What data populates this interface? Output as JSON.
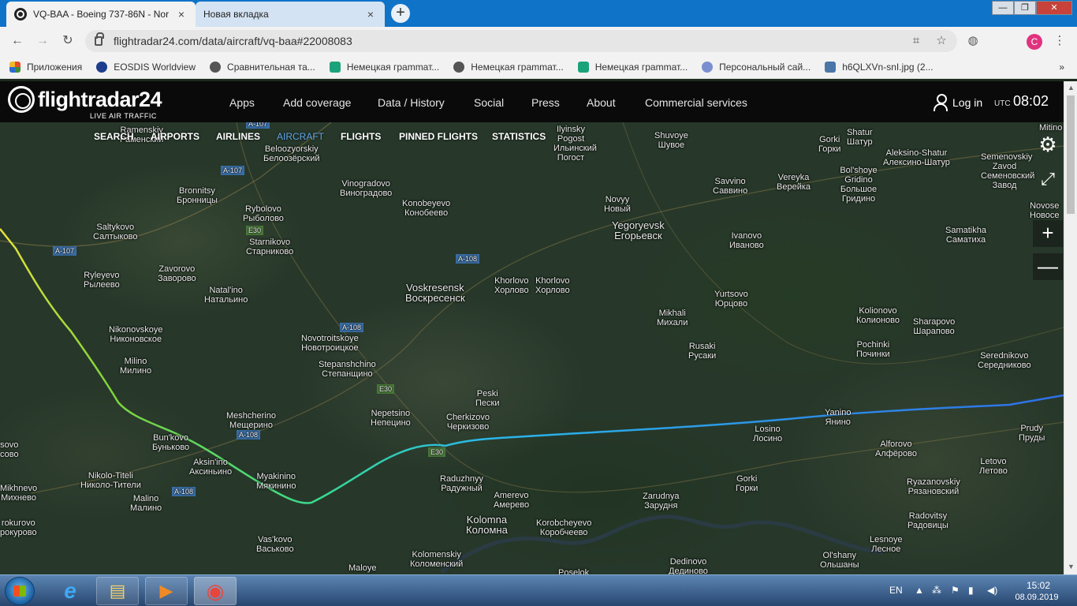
{
  "browser": {
    "tabs": [
      {
        "title": "VQ-BAA - Boeing 737-86N - Nor",
        "close": "×"
      },
      {
        "title": "Новая вкладка",
        "close": "×"
      }
    ],
    "new_tab": "+",
    "window": {
      "minimize": "—",
      "maximize": "❐",
      "close": "✕"
    },
    "url": "flightradar24.com/data/aircraft/vq-baa#22008083",
    "profile_initial": "C",
    "bookmarks": [
      {
        "label": "Приложения",
        "color": "#e44d26"
      },
      {
        "label": "EOSDIS Worldview",
        "color": "#1e3d8f"
      },
      {
        "label": "Сравнительная та...",
        "color": "#555555"
      },
      {
        "label": "Немецкая грammат...",
        "color": "#1aa37a"
      },
      {
        "label": "Немецкая грammат...",
        "color": "#555555"
      },
      {
        "label": "Немецкая грammат...",
        "color": "#1aa37a"
      },
      {
        "label": "Персональный сай...",
        "color": "#7b8fd0"
      },
      {
        "label": "h6QLXVn-snI.jpg (2...",
        "color": "#4a76a8"
      }
    ],
    "bookmarks_more": "»"
  },
  "fr24": {
    "logo": "flightradar24",
    "tagline": "LIVE AIR TRAFFIC",
    "nav": [
      "Apps",
      "Add coverage",
      "Data / History",
      "Social",
      "Press",
      "About",
      "Commercial services"
    ],
    "login": "Log in",
    "utc_label": "UTC",
    "time": "08:02",
    "subnav": [
      "SEARCH",
      "AIRPORTS",
      "AIRLINES",
      "AIRCRAFT",
      "FLIGHTS",
      "PINNED FLIGHTS",
      "STATISTICS"
    ],
    "controls": {
      "settings": "⚙",
      "fullscreen": "⤢",
      "zoom_in": "+",
      "zoom_out": "—"
    }
  },
  "map_places": [
    {
      "en": "Ramenskiy",
      "ru": "Раменский"
    },
    {
      "en": "Beloozyorskiy",
      "ru": "Белоозёрский"
    },
    {
      "en": "Bronnitsy",
      "ru": "Бронницы"
    },
    {
      "en": "Saltykovo",
      "ru": "Салтыково"
    },
    {
      "en": "Rybolovo",
      "ru": "Рыболово"
    },
    {
      "en": "Vinogradovo",
      "ru": "Виноградово"
    },
    {
      "en": "Konobeyevo",
      "ru": "Конобеево"
    },
    {
      "en": "Starnikovo",
      "ru": "Старниково"
    },
    {
      "en": "Ryleyevo",
      "ru": "Рылеево"
    },
    {
      "en": "Zavorovo",
      "ru": "Заворово"
    },
    {
      "en": "Natal'ino",
      "ru": "Натальино"
    },
    {
      "en": "Nikonovskoye",
      "ru": "Никоновское"
    },
    {
      "en": "Novotroitskoye",
      "ru": "Новотроицкое"
    },
    {
      "en": "Milino",
      "ru": "Милино"
    },
    {
      "en": "Stepanshchino",
      "ru": "Степанщино"
    },
    {
      "en": "Voskresensk",
      "ru": "Воскресенск"
    },
    {
      "en": "Khorlovo",
      "ru": "Хорлово"
    },
    {
      "en": "Khorlovo",
      "ru": "Хорлово"
    },
    {
      "en": "Ilyinsky Pogost",
      "ru": "Ильинский Погост"
    },
    {
      "en": "Shuvoye",
      "ru": "Шувое"
    },
    {
      "en": "Novyy",
      "ru": "Новый"
    },
    {
      "en": "Yegoryevsk",
      "ru": "Егорьевск"
    },
    {
      "en": "Savvino",
      "ru": "Саввино"
    },
    {
      "en": "Vereyka",
      "ru": "Верейка"
    },
    {
      "en": "Shatur",
      "ru": "Шатур"
    },
    {
      "en": "Gorki",
      "ru": "Горки"
    },
    {
      "en": "Aleksino-Shatur",
      "ru": "Алексино-Шатур"
    },
    {
      "en": "Semenovskiy Zavod",
      "ru": "Семеновский Завод"
    },
    {
      "en": "Bol'shoye Gridino",
      "ru": "Большое Гридино"
    },
    {
      "en": "Ivanovo",
      "ru": "Иваново"
    },
    {
      "en": "Samatikha",
      "ru": "Саматиха"
    },
    {
      "en": "Yurtsovo",
      "ru": "Юрцово"
    },
    {
      "en": "Mikhali",
      "ru": "Михали"
    },
    {
      "en": "Kolionovo",
      "ru": "Колионово"
    },
    {
      "en": "Sharapovo",
      "ru": "Шарапово"
    },
    {
      "en": "Rusaki",
      "ru": "Русаки"
    },
    {
      "en": "Pochinki",
      "ru": "Починки"
    },
    {
      "en": "Serednikovo",
      "ru": "Середниково"
    },
    {
      "en": "Peski",
      "ru": "Пески"
    },
    {
      "en": "Meshcherino",
      "ru": "Мещерино"
    },
    {
      "en": "Nepetsino",
      "ru": "Непецино"
    },
    {
      "en": "Cherkizovo",
      "ru": "Черкизово"
    },
    {
      "en": "Bun'kovo",
      "ru": "Буньково"
    },
    {
      "en": "Aksin'ino",
      "ru": "Аксиньино"
    },
    {
      "en": "Myakinino",
      "ru": "Мякинино"
    },
    {
      "en": "Nikolo-Titeli",
      "ru": "Николо-Тители"
    },
    {
      "en": "Malino",
      "ru": "Малино"
    },
    {
      "en": "Mikhnevo",
      "ru": "Михнево"
    },
    {
      "en": "Yanino",
      "ru": "Янино"
    },
    {
      "en": "Losino",
      "ru": "Лосино"
    },
    {
      "en": "Prudy",
      "ru": "Пруды"
    },
    {
      "en": "Alforovo",
      "ru": "Алфёрово"
    },
    {
      "en": "Letovo",
      "ru": "Летово"
    },
    {
      "en": "Raduzhnyy",
      "ru": "Радужный"
    },
    {
      "en": "Amerevo",
      "ru": "Амерево"
    },
    {
      "en": "Gorki",
      "ru": "Горки"
    },
    {
      "en": "Zarudnya",
      "ru": "Зарудня"
    },
    {
      "en": "Ryazanovskiy",
      "ru": "Рязановский"
    },
    {
      "en": "Kolomna",
      "ru": "Коломна"
    },
    {
      "en": "Korobcheyevo",
      "ru": "Коробчеево"
    },
    {
      "en": "Radovitsy",
      "ru": "Радовицы"
    },
    {
      "en": "Vas'kovo",
      "ru": "Васьково"
    },
    {
      "en": "Kolomenskiy",
      "ru": "Коломенский"
    },
    {
      "en": "Lesnoye",
      "ru": "Лесное"
    },
    {
      "en": "Dedinovo",
      "ru": "Дединово"
    },
    {
      "en": "Ol'shany",
      "ru": "Ольшаны"
    },
    {
      "en": "Maloye",
      "ru": ""
    },
    {
      "en": "Poselok",
      "ru": ""
    },
    {
      "en": "Mitino",
      "ru": ""
    },
    {
      "en": "Novose",
      "ru": "Новосе"
    },
    {
      "en": "sovo",
      "ru": "сово"
    },
    {
      "en": "rokurovo",
      "ru": "рокурово"
    }
  ],
  "road_labels": [
    "A-107",
    "A-107",
    "A-107",
    "E30",
    "A-108",
    "A-108",
    "E30",
    "A-108",
    "A-108",
    "E30"
  ],
  "flight_track": {
    "gradient_colors": [
      "#e8e23a",
      "#7fd43a",
      "#39d98f",
      "#2ab8e8",
      "#2f6fe8"
    ]
  },
  "taskbar": {
    "apps": [
      {
        "name": "internet-explorer",
        "glyph": "e"
      },
      {
        "name": "file-explorer",
        "glyph": "▤"
      },
      {
        "name": "media-player",
        "glyph": "▶"
      },
      {
        "name": "chrome",
        "glyph": "◉"
      }
    ],
    "lang": "EN",
    "time": "15:02",
    "date": "08.09.2019"
  }
}
